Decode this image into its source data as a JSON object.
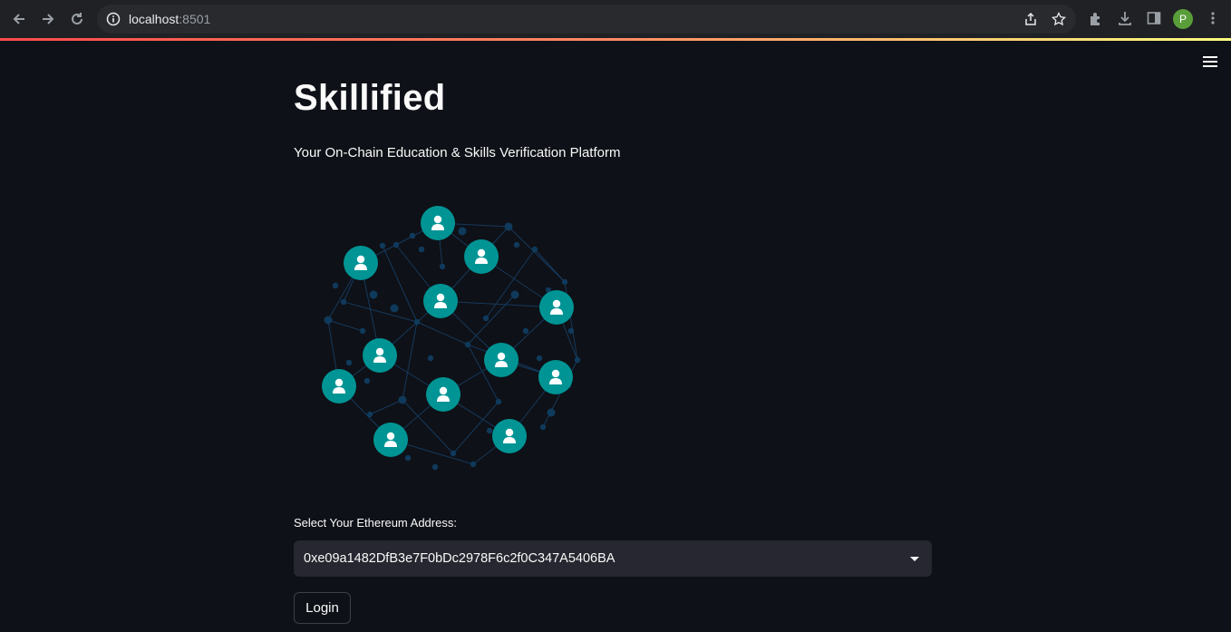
{
  "browser": {
    "url_host": "localhost",
    "url_port": ":8501",
    "profile_initial": "P"
  },
  "app": {
    "title": "Skillified",
    "subtitle": "Your On-Chain Education & Skills Verification Platform",
    "select_label": "Select Your Ethereum Address:",
    "selected_address": "0xe09a1482DfB3e7F0bDc2978F6c2f0C347A5406BA",
    "login_label": "Login"
  },
  "colors": {
    "background": "#0e1117",
    "node_teal": "#009494",
    "network_dot": "#0f3a5c",
    "accent_gradient": [
      "#ff4b4b",
      "#fffd80"
    ]
  }
}
